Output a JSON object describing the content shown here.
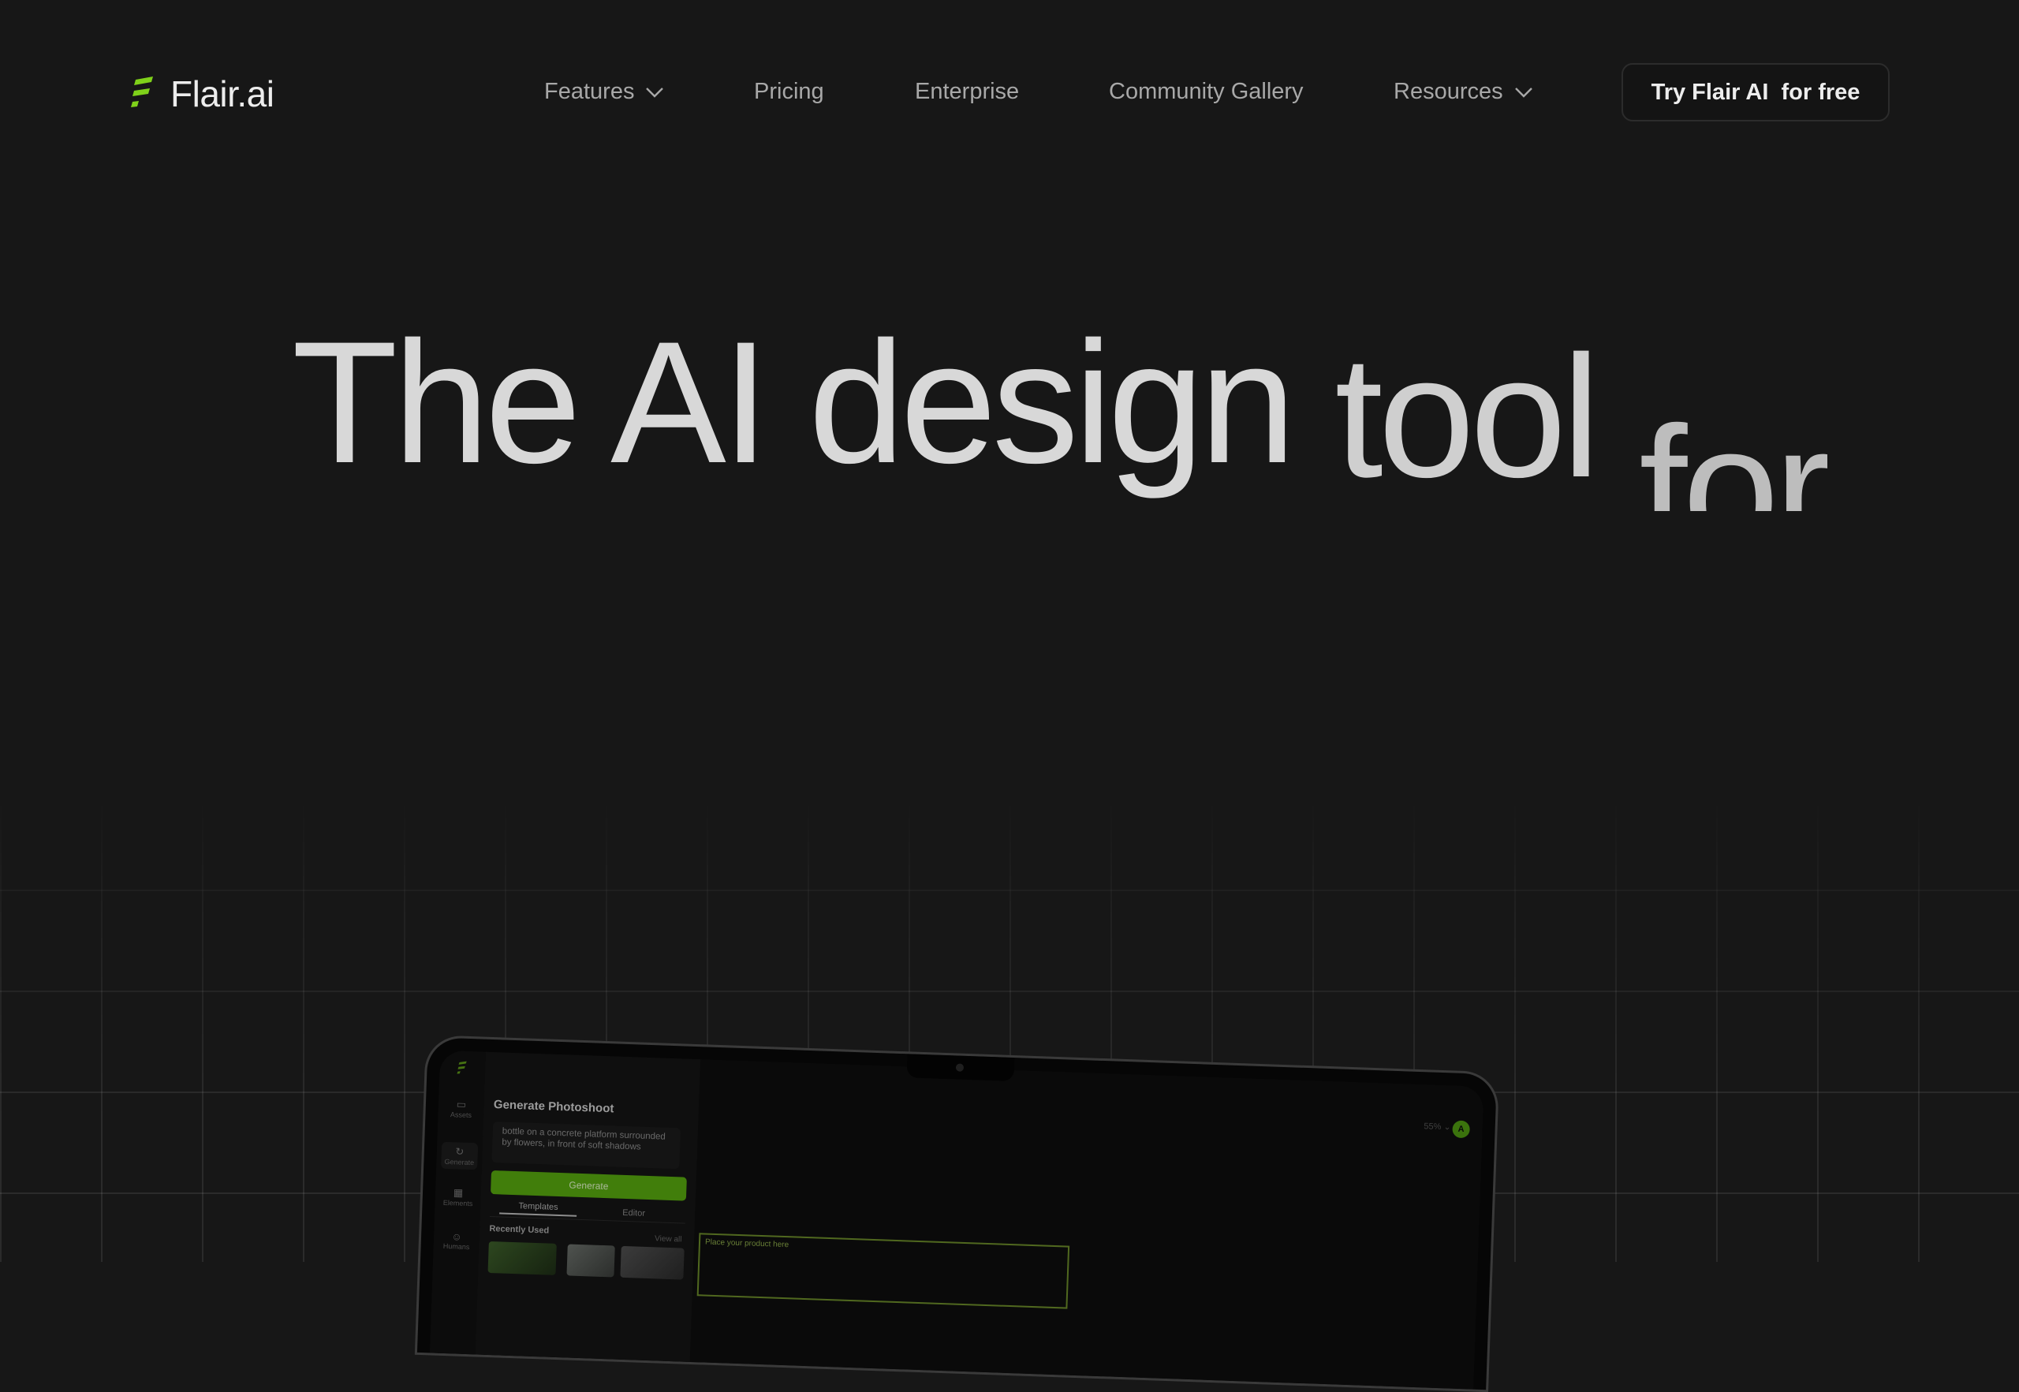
{
  "nav": {
    "logo_text": "Flair.ai",
    "items": [
      {
        "label": "Features",
        "has_dropdown": true
      },
      {
        "label": "Pricing",
        "has_dropdown": false
      },
      {
        "label": "Enterprise",
        "has_dropdown": false
      },
      {
        "label": "Community Gallery",
        "has_dropdown": false
      },
      {
        "label": "Resources",
        "has_dropdown": true
      }
    ],
    "cta_label": "Try Flair AI  for free"
  },
  "hero": {
    "line_parts": [
      "The AI design",
      "tool",
      "for"
    ]
  },
  "app_preview": {
    "rail_items": [
      "Assets",
      "Generate",
      "Elements",
      "Humans"
    ],
    "panel_title": "Generate Photoshoot",
    "prompt_text": "bottle on a concrete platform surrounded by flowers, in front of soft shadows",
    "generate_label": "Generate",
    "tabs": [
      "Templates",
      "Editor"
    ],
    "recent_label": "Recently Used",
    "view_all": "View all",
    "zoom": "55%",
    "avatar_initial": "A",
    "drop_label": "Place your product here"
  },
  "colors": {
    "background": "#171717",
    "accent_green": "#57a80f",
    "logo_green": "#7fd11a"
  }
}
